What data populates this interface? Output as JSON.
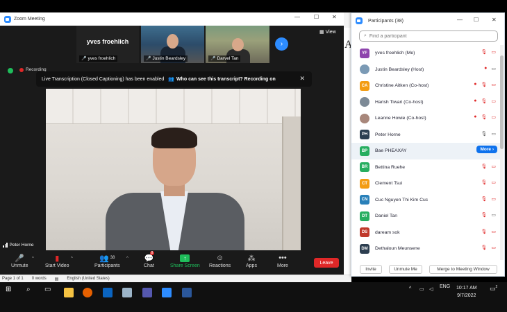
{
  "zoom": {
    "window_title": "Zoom Meeting",
    "view_label": "View",
    "recording_label": "Recording",
    "banner_text": "Live Transcription (Closed Captioning) has been enabled",
    "banner_link": "Who can see this transcript? Recording on",
    "thumbnails": [
      {
        "big_name": "yves froehlich",
        "label": "yves froehlich"
      },
      {
        "label": "Justin Beardsley"
      },
      {
        "label": "Darvel Tan"
      }
    ],
    "active_speaker": "Peter Horne"
  },
  "toolbar": {
    "unmute": "Unmute",
    "start_video": "Start Video",
    "participants": "Participants",
    "participants_count": "38",
    "chat": "Chat",
    "chat_badge": "8",
    "share_screen": "Share Screen",
    "reactions": "Reactions",
    "apps": "Apps",
    "more": "More",
    "leave": "Leave"
  },
  "panel": {
    "title": "Participants (38)",
    "search_placeholder": "Find a participant",
    "more_label": "More",
    "participants": [
      {
        "initials": "YF",
        "name": "yves froehlich (Me)",
        "color": "#8e44ad",
        "photo": false
      },
      {
        "initials": "",
        "name": "Justin Beardsley (Host)",
        "color": "#7b9ab5",
        "photo": true
      },
      {
        "initials": "CA",
        "name": "Christine Aitken (Co-host)",
        "color": "#f39c12",
        "photo": false
      },
      {
        "initials": "",
        "name": "Harish Tiwari (Co-host)",
        "color": "#7d8a96",
        "photo": true
      },
      {
        "initials": "",
        "name": "Leanne Howie (Co-host)",
        "color": "#a8877b",
        "photo": true
      },
      {
        "initials": "PH",
        "name": "Peter Horne",
        "color": "#2c3e50",
        "photo": false
      },
      {
        "initials": "BP",
        "name": "Bae PHEAXAY",
        "color": "#27ae60",
        "photo": false
      },
      {
        "initials": "BR",
        "name": "Bettina Ruehe",
        "color": "#27ae60",
        "photo": false
      },
      {
        "initials": "CT",
        "name": "Clement Tsui",
        "color": "#f39c12",
        "photo": false
      },
      {
        "initials": "CN",
        "name": "Cuc Nguyen Thi Kim Cuc",
        "color": "#2980b9",
        "photo": false
      },
      {
        "initials": "DT",
        "name": "Daniel Tan",
        "color": "#27ae60",
        "photo": false
      },
      {
        "initials": "DS",
        "name": "daream sok",
        "color": "#c0392b",
        "photo": false
      },
      {
        "initials": "DM",
        "name": "Dethaloun Meunsene",
        "color": "#2c3e50",
        "photo": false
      }
    ],
    "invite": "Invite",
    "unmute_me": "Unmute Me",
    "merge": "Merge to Meeting Window"
  },
  "word": {
    "page_info": "Page 1 of 1",
    "words": "0 words",
    "language": "English (United States)",
    "letter": "A"
  },
  "taskbar": {
    "language": "ENG",
    "time": "10:17 AM",
    "date": "9/7/2022",
    "notif_count": "2"
  }
}
